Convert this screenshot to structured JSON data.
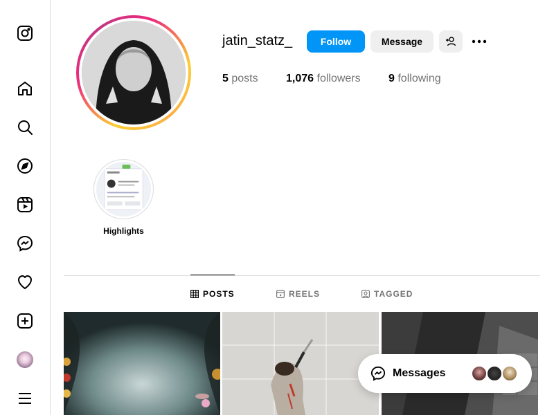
{
  "sidebar": {
    "items": [
      {
        "name": "instagram-logo",
        "label": "Instagram"
      },
      {
        "name": "home",
        "label": "Home"
      },
      {
        "name": "search",
        "label": "Search"
      },
      {
        "name": "explore",
        "label": "Explore"
      },
      {
        "name": "reels",
        "label": "Reels"
      },
      {
        "name": "messages",
        "label": "Messages"
      },
      {
        "name": "notifications",
        "label": "Notifications"
      },
      {
        "name": "create",
        "label": "Create"
      },
      {
        "name": "profile",
        "label": "Profile"
      },
      {
        "name": "more",
        "label": "More"
      }
    ]
  },
  "profile": {
    "username": "jatin_statz_",
    "follow_label": "Follow",
    "message_label": "Message",
    "stats": {
      "posts_count": "5",
      "posts_label": "posts",
      "followers_count": "1,076",
      "followers_label": "followers",
      "following_count": "9",
      "following_label": "following"
    },
    "bio": "ᅠᅠᅠᅠ"
  },
  "highlights": [
    {
      "label": "Highlights"
    }
  ],
  "tabs": [
    {
      "label": "POSTS",
      "active": true
    },
    {
      "label": "REELS",
      "active": false
    },
    {
      "label": "TAGGED",
      "active": false
    }
  ],
  "messages_bar": {
    "label": "Messages"
  },
  "colors": {
    "accent": "#0095f6",
    "secondary_button": "#efefef",
    "divider": "#dbdbdb",
    "muted_text": "#737373"
  }
}
